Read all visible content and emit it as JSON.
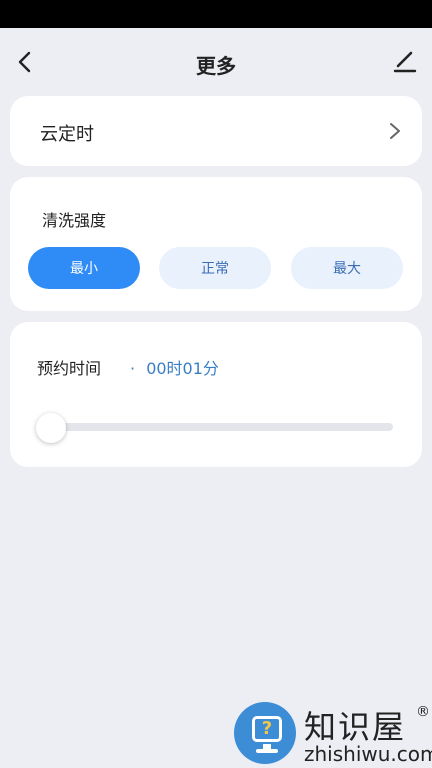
{
  "header": {
    "title": "更多"
  },
  "timer": {
    "label": "云定时"
  },
  "intensity": {
    "label": "清洗强度",
    "options": [
      "最小",
      "正常",
      "最大"
    ],
    "selected": "最小"
  },
  "schedule": {
    "label": "预约时间",
    "separator": "·",
    "value": "00时01分",
    "slider_fraction": 0.0
  },
  "watermark": {
    "brand_cn": "知识屋",
    "registered": "®",
    "domain": "zhishiwu.com",
    "icon_glyph": "?"
  },
  "colors": {
    "accent": "#2f8bf5",
    "accent_light": "#e8f1fc",
    "value_text": "#3a7fc4"
  },
  "icons": {
    "back": "chevron-left-icon",
    "edit": "pencil-icon",
    "chevron": "chevron-right-icon"
  }
}
